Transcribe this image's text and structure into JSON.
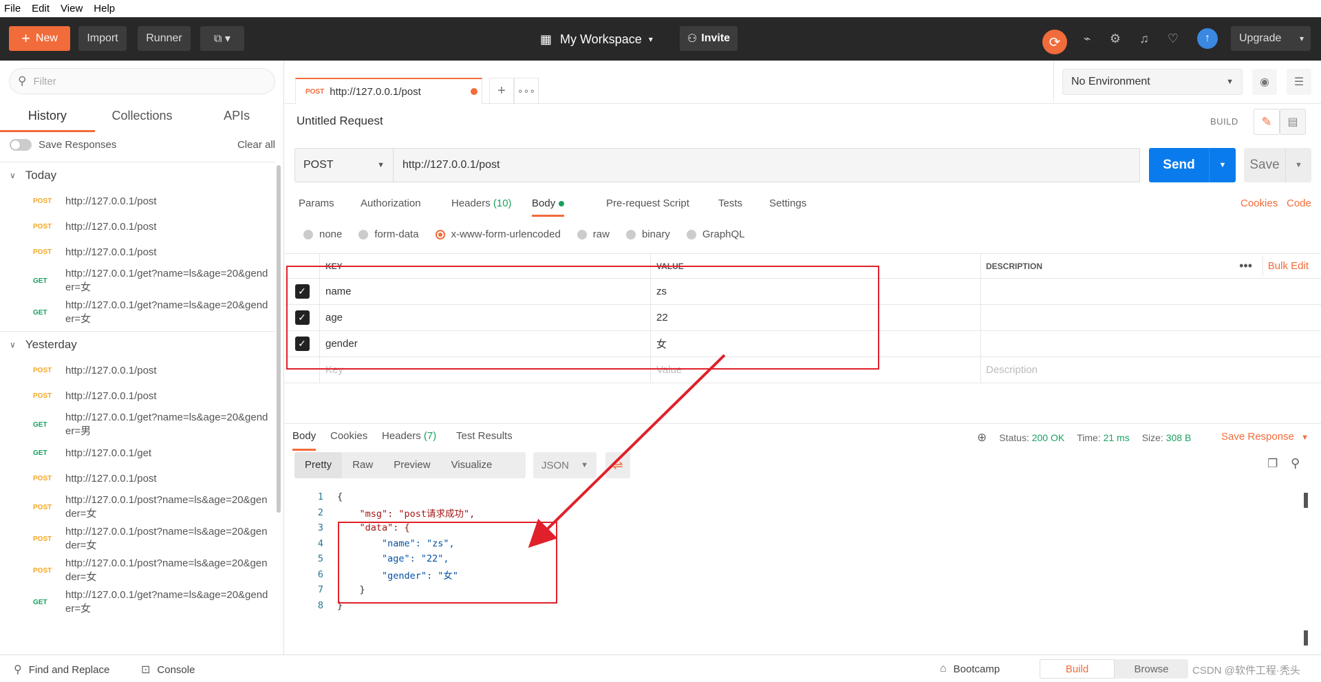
{
  "menu": [
    "File",
    "Edit",
    "View",
    "Help"
  ],
  "toolbar": {
    "new_label": "New",
    "import_label": "Import",
    "runner_label": "Runner",
    "workspace": "My Workspace",
    "invite": "Invite",
    "upgrade": "Upgrade",
    "sync_color": "#f26b3a"
  },
  "sidebar": {
    "filter_placeholder": "Filter",
    "tabs": [
      "History",
      "Collections",
      "APIs"
    ],
    "save_responses": "Save Responses",
    "clear_all": "Clear all",
    "groups": [
      {
        "label": "Today",
        "items": [
          {
            "method": "POST",
            "url": "http://127.0.0.1/post"
          },
          {
            "method": "POST",
            "url": "http://127.0.0.1/post"
          },
          {
            "method": "POST",
            "url": "http://127.0.0.1/post"
          },
          {
            "method": "GET",
            "url": "http://127.0.0.1/get?name=ls&age=20&gender=女"
          },
          {
            "method": "GET",
            "url": "http://127.0.0.1/get?name=ls&age=20&gender=女"
          }
        ]
      },
      {
        "label": "Yesterday",
        "items": [
          {
            "method": "POST",
            "url": "http://127.0.0.1/post"
          },
          {
            "method": "POST",
            "url": "http://127.0.0.1/post"
          },
          {
            "method": "GET",
            "url": "http://127.0.0.1/get?name=ls&age=20&gender=男"
          },
          {
            "method": "GET",
            "url": "http://127.0.0.1/get"
          },
          {
            "method": "POST",
            "url": "http://127.0.0.1/post"
          },
          {
            "method": "POST",
            "url": "http://127.0.0.1/post?name=ls&age=20&gender=女"
          },
          {
            "method": "POST",
            "url": "http://127.0.0.1/post?name=ls&age=20&gender=女"
          },
          {
            "method": "POST",
            "url": "http://127.0.0.1/post?name=ls&age=20&gender=女"
          },
          {
            "method": "GET",
            "url": "http://127.0.0.1/get?name=ls&age=20&gender=女"
          }
        ]
      }
    ]
  },
  "tab": {
    "method": "POST",
    "url": "http://127.0.0.1/post"
  },
  "environment": "No Environment",
  "request": {
    "title": "Untitled Request",
    "build": "BUILD",
    "method": "POST",
    "url": "http://127.0.0.1/post",
    "send": "Send",
    "save": "Save",
    "tabs": {
      "params": "Params",
      "authorization": "Authorization",
      "headers": "Headers",
      "headers_count": "(10)",
      "body": "Body",
      "prerequest": "Pre-request Script",
      "tests": "Tests",
      "settings": "Settings"
    },
    "cookies": "Cookies",
    "code": "Code",
    "body_types": [
      "none",
      "form-data",
      "x-www-form-urlencoded",
      "raw",
      "binary",
      "GraphQL"
    ],
    "selected_body_type": "x-www-form-urlencoded",
    "table": {
      "headers": {
        "key": "KEY",
        "value": "VALUE",
        "description": "DESCRIPTION",
        "bulk_edit": "Bulk Edit"
      },
      "rows": [
        {
          "key": "name",
          "value": "zs",
          "checked": true
        },
        {
          "key": "age",
          "value": "22",
          "checked": true
        },
        {
          "key": "gender",
          "value": "女",
          "checked": true
        }
      ],
      "placeholder": {
        "key": "Key",
        "value": "Value",
        "description": "Description"
      }
    }
  },
  "response": {
    "tabs": {
      "body": "Body",
      "cookies": "Cookies",
      "headers": "Headers",
      "headers_count": "(7)",
      "test_results": "Test Results"
    },
    "status_label": "Status:",
    "status": "200 OK",
    "time_label": "Time:",
    "time": "21 ms",
    "size_label": "Size:",
    "size": "308 B",
    "save_response": "Save Response",
    "formats": [
      "Pretty",
      "Raw",
      "Preview",
      "Visualize"
    ],
    "language": "JSON",
    "code_lines": [
      {
        "n": "1",
        "text": "{"
      },
      {
        "n": "2",
        "text": "    \"msg\": \"post请求成功\","
      },
      {
        "n": "3",
        "text": "    \"data\": {"
      },
      {
        "n": "4",
        "text": "        \"name\": \"zs\","
      },
      {
        "n": "5",
        "text": "        \"age\": \"22\","
      },
      {
        "n": "6",
        "text": "        \"gender\": \"女\""
      },
      {
        "n": "7",
        "text": "    }"
      },
      {
        "n": "8",
        "text": "}"
      }
    ]
  },
  "footer": {
    "find_replace": "Find and Replace",
    "console": "Console",
    "bootcamp": "Bootcamp",
    "build": "Build",
    "browse": "Browse",
    "watermark": "CSDN @软件工程·秃头"
  }
}
